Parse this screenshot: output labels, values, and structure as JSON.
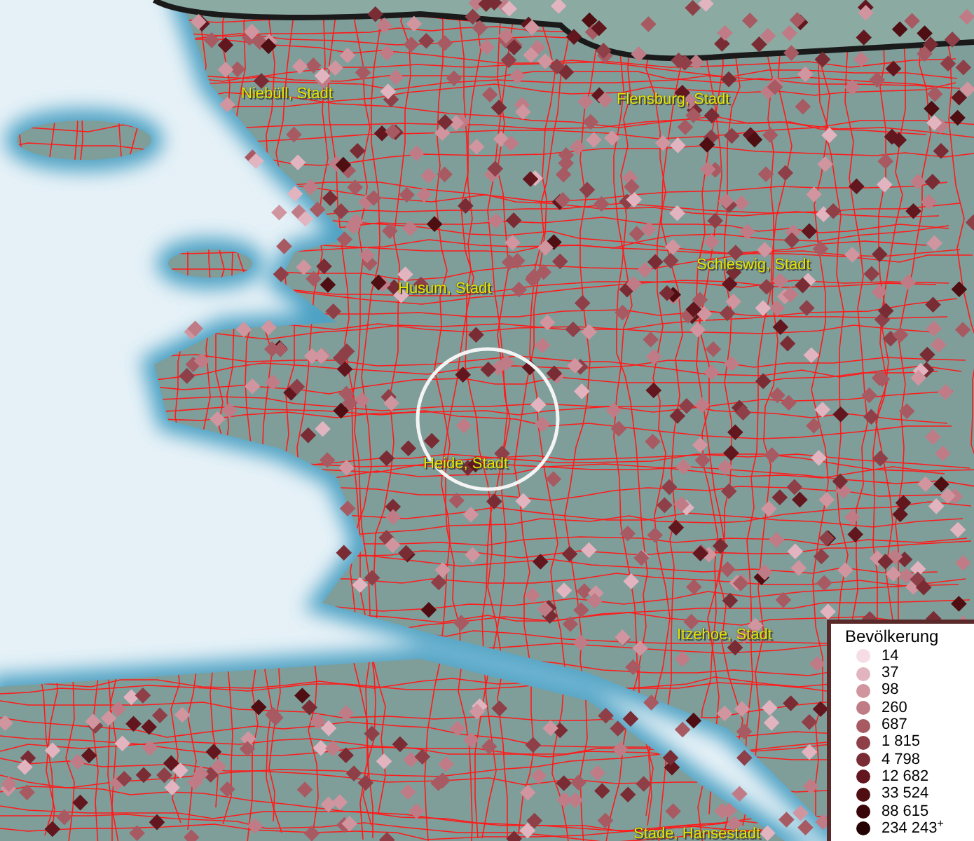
{
  "map": {
    "places": [
      {
        "label": "Niebüll, Stadt"
      },
      {
        "label": "Flensburg, Stadt"
      },
      {
        "label": "Schleswig, Stadt"
      },
      {
        "label": "Husum, Stadt"
      },
      {
        "label": "Heide, Stadt"
      },
      {
        "label": "Itzehoe, Stadt"
      },
      {
        "label": "Stade, Hansestadt"
      }
    ]
  },
  "legend": {
    "title": "Bevölkerung",
    "items": [
      {
        "label": "14",
        "color": "#f5dce6"
      },
      {
        "label": "37",
        "color": "#e2b4c0"
      },
      {
        "label": "98",
        "color": "#d0959f"
      },
      {
        "label": "260",
        "color": "#c07c86"
      },
      {
        "label": "687",
        "color": "#a85a63"
      },
      {
        "label": "1 815",
        "color": "#8e3f47"
      },
      {
        "label": "4 798",
        "color": "#7a2c34"
      },
      {
        "label": "12 682",
        "color": "#62161e"
      },
      {
        "label": "33 524",
        "color": "#4e0e12"
      },
      {
        "label": "88 615",
        "color": "#3a0508"
      },
      {
        "label": "234 243$^{+}$",
        "color": "#250204"
      }
    ]
  }
}
